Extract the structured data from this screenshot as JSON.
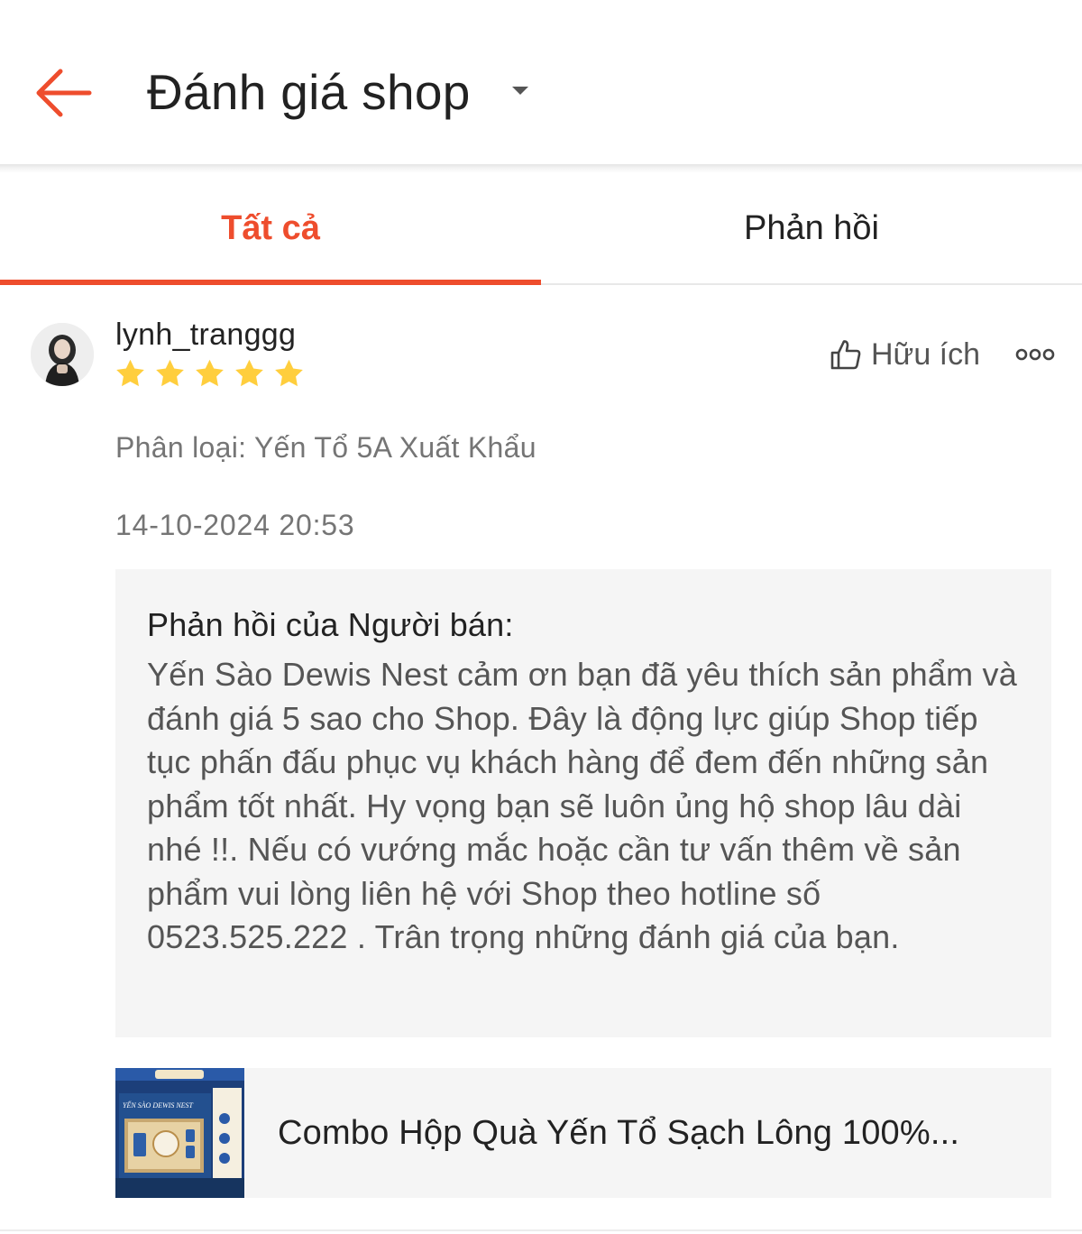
{
  "header": {
    "title": "Đánh giá shop",
    "back_icon": "arrow-left-icon",
    "dropdown_icon": "caret-down-icon"
  },
  "tabs": [
    {
      "label": "Tất cả",
      "active": true
    },
    {
      "label": "Phản hồi",
      "active": false
    }
  ],
  "review": {
    "username": "lynh_tranggg",
    "rating": 5,
    "max_rating": 5,
    "helpful_label": "Hữu ích",
    "variation": "Phân loại: Yến Tổ 5A Xuất Khẩu",
    "timestamp": "14-10-2024 20:53",
    "seller_reply": {
      "title": "Phản hồi của Người bán:",
      "body": "Yến Sào Dewis Nest cảm ơn bạn đã yêu thích sản phẩm và đánh giá 5 sao cho Shop. Đây là động lực giúp Shop tiếp tục phấn đấu phục vụ khách hàng để đem đến những sản phẩm tốt nhất. Hy vọng bạn sẽ luôn ủng hộ shop lâu dài nhé !!. Nếu có vướng mắc hoặc cần tư vấn thêm về sản phẩm vui lòng liên hệ với Shop theo hotline số 0523.525.222 . Trân trọng những đánh giá của bạn."
    },
    "product": {
      "name": "Combo Hộp Quà Yến Tổ Sạch Lông 100%...",
      "thumb_text": "YẾN SÀO DEWIS NEST"
    }
  },
  "colors": {
    "accent": "#ee4d2d",
    "star": "#ffce3d",
    "text_primary": "#222222",
    "text_secondary": "#757575",
    "reply_bg": "#f5f5f5"
  }
}
